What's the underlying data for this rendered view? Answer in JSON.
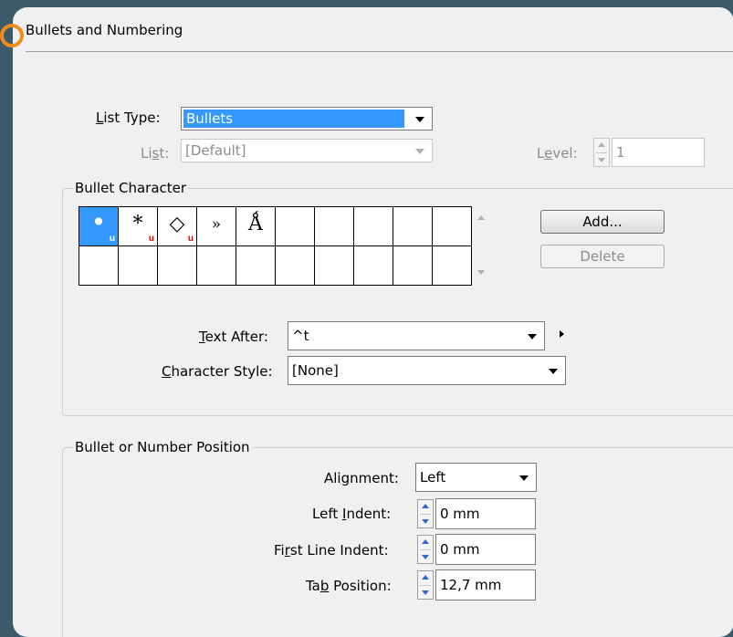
{
  "dialog": {
    "title": "Bullets and Numbering"
  },
  "list_type": {
    "label_key": "L",
    "label_rest": "ist Type:",
    "value": "Bullets"
  },
  "list": {
    "label_pre": "Li",
    "label_key": "s",
    "label_rest": "t:",
    "value": "[Default]"
  },
  "level": {
    "label_pre": "L",
    "label_key": "e",
    "label_rest": "vel:",
    "value": "1"
  },
  "bullet_character": {
    "group_label": "Bullet Character",
    "glyphs": [
      "•",
      "*",
      "◇",
      "»",
      "Ǻ",
      "",
      "",
      "",
      "",
      "",
      "",
      "",
      "",
      "",
      "",
      "",
      "",
      "",
      "",
      ""
    ],
    "badges": [
      "u",
      "u",
      "u",
      "",
      "",
      "",
      "",
      "",
      "",
      "",
      "",
      "",
      "",
      "",
      "",
      "",
      "",
      "",
      "",
      ""
    ],
    "add_label": "Add...",
    "delete_label": "Delete"
  },
  "text_after": {
    "label_key": "T",
    "label_rest": "ext After:",
    "value": "^t"
  },
  "character_style": {
    "label_key": "C",
    "label_rest": "haracter Style:",
    "value": "[None]"
  },
  "position": {
    "group_label": "Bullet or Number Position",
    "alignment": {
      "label_pre": "Ali",
      "label_key": "g",
      "label_rest": "nment:",
      "value": "Left"
    },
    "left_indent": {
      "label_pre": "Left ",
      "label_key": "I",
      "label_rest": "ndent:",
      "value": "0 mm"
    },
    "first_line_indent": {
      "label_pre": "Fi",
      "label_key": "r",
      "label_rest": "st Line Indent:",
      "value": "0 mm"
    },
    "tab_position": {
      "label_pre": "Ta",
      "label_key": "b",
      "label_rest": " Position:",
      "value": "12,7 mm"
    }
  },
  "colors": {
    "selection": "#3399ff",
    "highlight_ring": "#f08c1e",
    "badge": "#e00000"
  }
}
